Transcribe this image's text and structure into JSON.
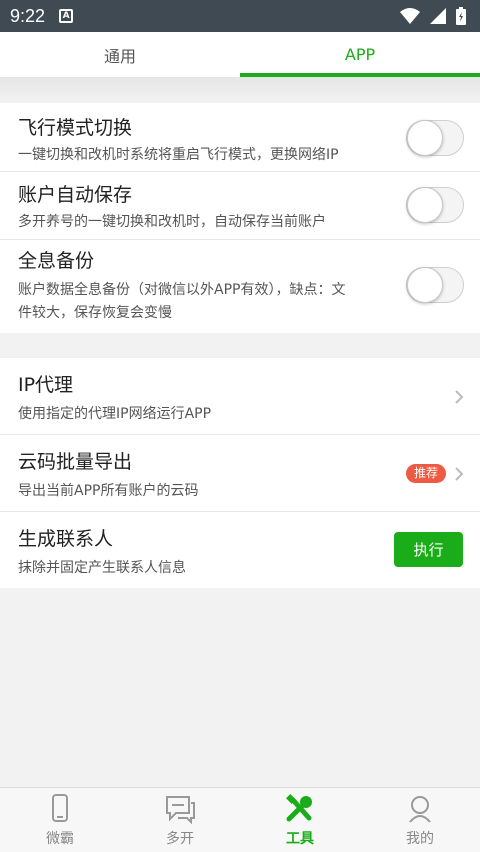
{
  "status_bar": {
    "time": "9:22",
    "notification_icon": "A"
  },
  "tabs": [
    {
      "label": "通用",
      "active": false
    },
    {
      "label": "APP",
      "active": true
    }
  ],
  "settings_toggles": [
    {
      "title": "飞行模式切换",
      "desc": "一键切换和改机时系统将重启飞行模式，更换网络IP",
      "enabled": false
    },
    {
      "title": "账户自动保存",
      "desc": "多开养号的一键切换和改机时，自动保存当前账户",
      "enabled": false
    },
    {
      "title": "全息备份",
      "desc_line1": "账户数据全息备份（对微信以外APP有效），缺点：文",
      "desc_line2": "件较大，保存恢复会变慢",
      "enabled": false
    }
  ],
  "actions": [
    {
      "title": "IP代理",
      "desc": "使用指定的代理IP网络运行APP"
    },
    {
      "title": "云码批量导出",
      "desc": "导出当前APP所有账户的云码",
      "badge": "推荐"
    },
    {
      "title": "生成联系人",
      "desc": "抹除并固定产生联系人信息",
      "button": "执行"
    }
  ],
  "bottom_nav": [
    {
      "label": "微霸",
      "icon": "phone-icon",
      "active": false
    },
    {
      "label": "多开",
      "icon": "chat-icon",
      "active": false
    },
    {
      "label": "工具",
      "icon": "tools-icon",
      "active": true
    },
    {
      "label": "我的",
      "icon": "user-icon",
      "active": false
    }
  ],
  "colors": {
    "accent": "#1aad19",
    "badge": "#ee5b45",
    "status_bar": "#3f4a53"
  }
}
